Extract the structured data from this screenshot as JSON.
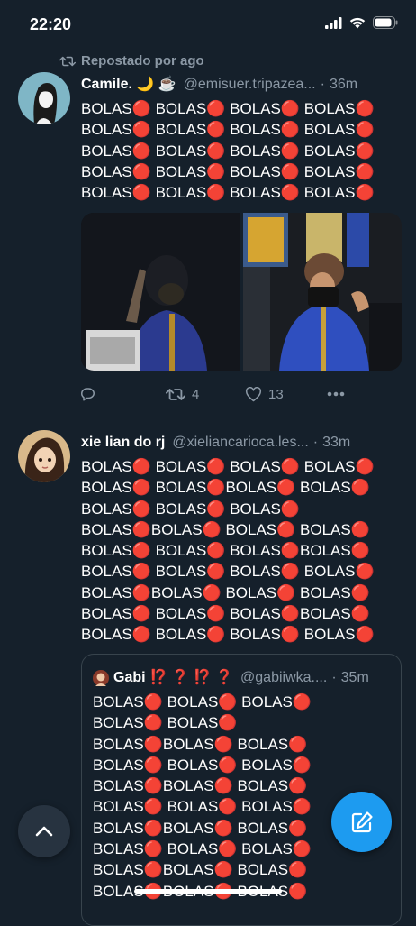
{
  "status_bar": {
    "time": "22:20"
  },
  "colors": {
    "background": "#15202b",
    "accent": "#1d9bf0",
    "muted": "#8b98a5",
    "red_circle": "#e0132a"
  },
  "tweets": [
    {
      "repost_label": "Repostado por ago",
      "author_name": "Camile. 🌙 ☕",
      "handle": "@emisuer.tripazea...",
      "dot": "·",
      "time": "36m",
      "text": "BOLAS🔴 BOLAS🔴 BOLAS🔴 BOLAS🔴\nBOLAS🔴 BOLAS🔴 BOLAS🔴 BOLAS🔴\nBOLAS🔴 BOLAS🔴 BOLAS🔴 BOLAS🔴\nBOLAS🔴 BOLAS🔴 BOLAS🔴 BOLAS🔴\nBOLAS🔴 BOLAS🔴 BOLAS🔴 BOLAS🔴",
      "actions": {
        "reposts": "4",
        "likes": "13"
      }
    },
    {
      "author_name": "xie lian do rj",
      "handle": "@xieliancarioca.les...",
      "dot": "·",
      "time": "33m",
      "text": "BOLAS🔴 BOLAS🔴 BOLAS🔴 BOLAS🔴\nBOLAS🔴 BOLAS🔴BOLAS🔴 BOLAS🔴\nBOLAS🔴 BOLAS🔴 BOLAS🔴\nBOLAS🔴BOLAS🔴 BOLAS🔴 BOLAS🔴\nBOLAS🔴 BOLAS🔴 BOLAS🔴BOLAS🔴\nBOLAS🔴 BOLAS🔴 BOLAS🔴 BOLAS🔴\nBOLAS🔴BOLAS🔴 BOLAS🔴 BOLAS🔴\nBOLAS🔴 BOLAS🔴 BOLAS🔴BOLAS🔴\nBOLAS🔴 BOLAS🔴 BOLAS🔴 BOLAS🔴",
      "quote": {
        "author_name": "Gabi ⁉️ ❓ ⁉️ ❓",
        "handle": "@gabiiwka....",
        "dot": "·",
        "time": "35m",
        "text": "BOLAS🔴 BOLAS🔴 BOLAS🔴\nBOLAS🔴 BOLAS🔴\nBOLAS🔴BOLAS🔴 BOLAS🔴\nBOLAS🔴 BOLAS🔴 BOLAS🔴\nBOLAS🔴BOLAS🔴 BOLAS🔴\nBOLAS🔴 BOLAS🔴 BOLAS🔴\nBOLAS🔴BOLAS🔴 BOLAS🔴\nBOLAS🔴 BOLAS🔴 BOLAS🔴\nBOLAS🔴BOLAS🔴 BOLAS🔴\nBOLAS🔴BOLAS🔴 BOLAS🔴"
      }
    }
  ]
}
